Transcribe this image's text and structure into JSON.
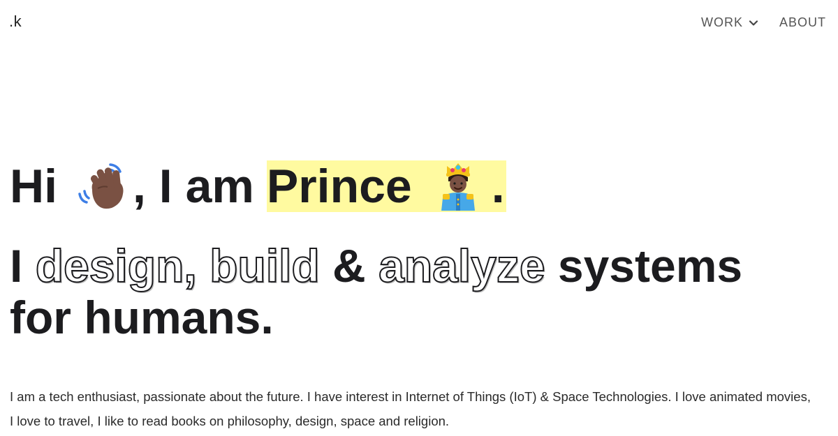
{
  "header": {
    "logo": ".k",
    "nav": [
      {
        "label": "WORK",
        "has_dropdown": true,
        "icon": "chevron-down-icon"
      },
      {
        "label": "ABOUT",
        "has_dropdown": false
      }
    ]
  },
  "hero": {
    "greeting_hi": "Hi",
    "greeting_emoji": "waving-hand-icon",
    "greeting_mid": ", I am",
    "name": "Prince",
    "name_emoji": "prince-icon",
    "period": ".",
    "tagline_i": "I",
    "tagline_design": "design,",
    "tagline_build": "build",
    "tagline_amp": "&",
    "tagline_analyze": "analyze",
    "tagline_systems": "systems",
    "tagline_line2": "for humans."
  },
  "intro_text": "I am a tech enthusiast, passionate about the future. I have interest in Internet of Things (IoT) & Space Technologies. I love animated movies, I love to travel, I like to read books on philosophy, design, space and religion.",
  "colors": {
    "highlight": "#fffaa0",
    "text": "#1c1c1f",
    "nav_text": "#555555"
  }
}
